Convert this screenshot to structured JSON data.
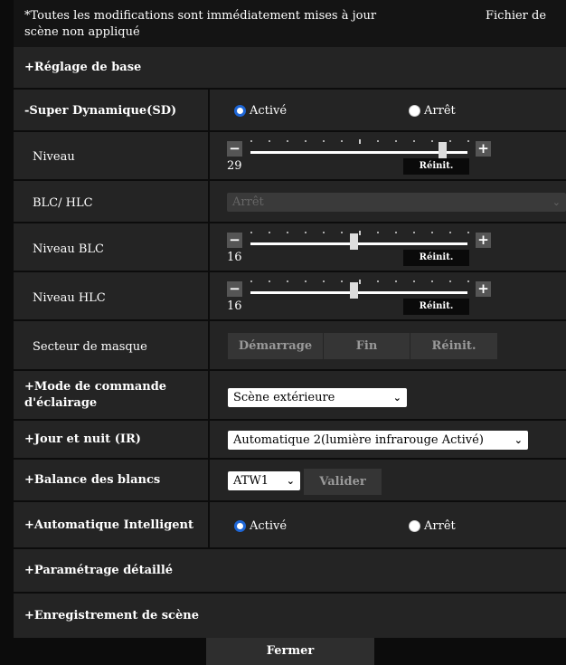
{
  "notice": {
    "line1": "*Toutes les modifications sont immédiatement mises à jour",
    "line1_right": "Fichier de",
    "line2": "scène non appliqué"
  },
  "sections": {
    "basic": "+Réglage de base",
    "sd_label": "-Super Dynamique(SD)",
    "sd_on": "Activé",
    "sd_off": "Arrêt",
    "lighting_mode_l1": "+Mode de commande",
    "lighting_mode_l2": "d'éclairage",
    "lighting_mode_value": "Scène extérieure",
    "day_night": "+Jour et nuit (IR)",
    "day_night_value": "Automatique 2(lumière infrarouge Activé)",
    "white_balance": "+Balance des blancs",
    "white_balance_value": "ATW1",
    "white_balance_apply": "Valider",
    "intelligent_auto": "+Automatique Intelligent",
    "ia_on": "Activé",
    "ia_off": "Arrêt",
    "detailed": "+Paramétrage détaillé",
    "scene_save": "+Enregistrement de scène"
  },
  "sd": {
    "niveau": {
      "label": "Niveau",
      "value": "29",
      "level": 29,
      "max": 32,
      "reset": "Réinit."
    },
    "blc_hlc": {
      "label": "BLC/ HLC",
      "value": "Arrêt"
    },
    "niveau_blc": {
      "label": "Niveau BLC",
      "value": "16",
      "level": 16,
      "max": 32,
      "reset": "Réinit."
    },
    "niveau_hlc": {
      "label": "Niveau HLC",
      "value": "16",
      "level": 16,
      "max": 32,
      "reset": "Réinit."
    },
    "mask": {
      "label": "Secteur de masque",
      "start": "Démarrage",
      "end": "Fin",
      "reset": "Réinit."
    }
  },
  "footer": {
    "close": "Fermer"
  },
  "colors": {
    "accent": "#1e66d6",
    "panel": "#242424",
    "background": "#0c0c0c"
  }
}
